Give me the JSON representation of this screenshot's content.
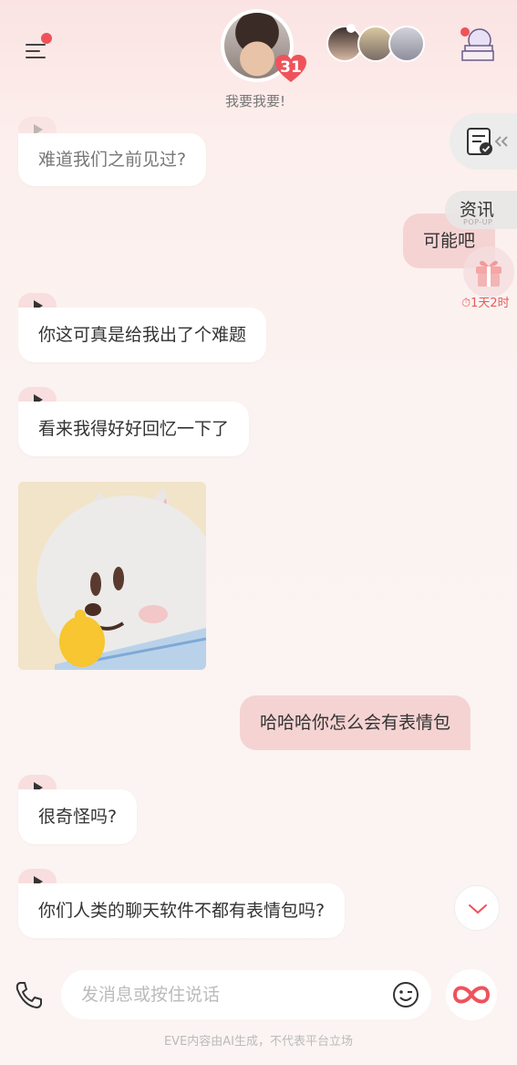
{
  "header": {
    "subtitle": "我要我要!",
    "affection_count": "31",
    "icons": [
      "menu-icon",
      "character-avatar",
      "heart-badge",
      "friend-avatars",
      "gift-tower-icon"
    ]
  },
  "side": {
    "news_label": "资讯",
    "news_sub": "POP-UP",
    "gift_timer": "⏱1天2时"
  },
  "messages": [
    {
      "role": "ai",
      "text": "难道我们之前见过?"
    },
    {
      "role": "user",
      "text": "可能吧"
    },
    {
      "role": "ai",
      "text": "你这可真是给我出了个难题"
    },
    {
      "role": "ai",
      "text": "看来我得好好回忆一下了"
    },
    {
      "role": "ai",
      "type": "sticker"
    },
    {
      "role": "user",
      "text": "哈哈哈你怎么会有表情包"
    },
    {
      "role": "ai",
      "text": "很奇怪吗?"
    },
    {
      "role": "ai",
      "text": "你们人类的聊天软件不都有表情包吗?"
    }
  ],
  "input": {
    "placeholder": "发消息或按住说话"
  },
  "footer": {
    "disclaimer": "EVE内容由AI生成，不代表平台立场"
  },
  "colors": {
    "accent": "#f0525a",
    "user_bubble": "#f5d3d3",
    "ai_bubble": "#ffffff"
  }
}
